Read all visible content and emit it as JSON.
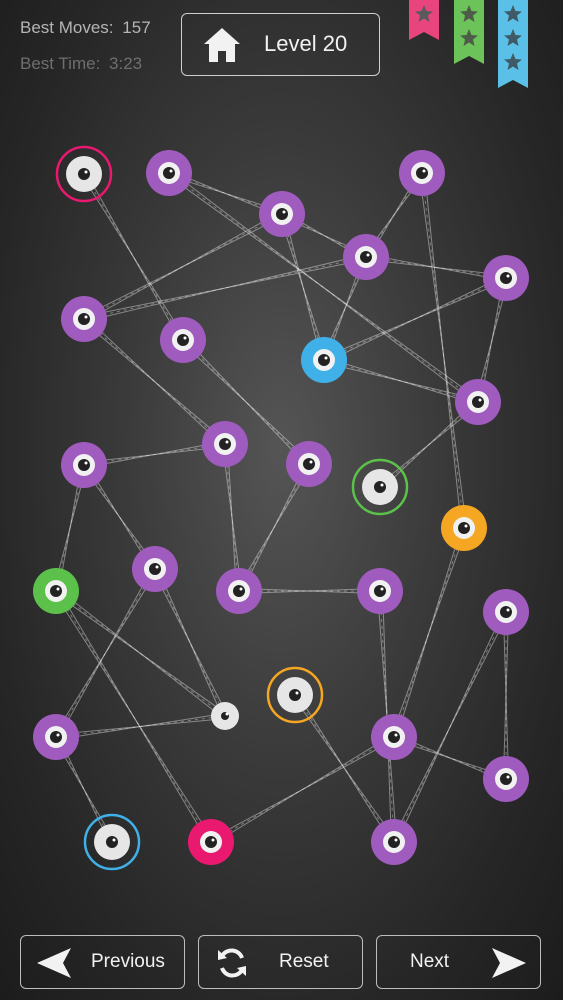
{
  "header": {
    "best_moves_label": "Best Moves:",
    "best_moves_value": "157",
    "best_time_label": "Best Time:",
    "best_time_value": "3:23",
    "level_label": "Level 20",
    "home_icon": "home-icon"
  },
  "ribbons": [
    {
      "color": "#e8457f",
      "stars": 1
    },
    {
      "color": "#6cc35a",
      "stars": 2
    },
    {
      "color": "#5bc0e8",
      "stars": 3
    }
  ],
  "colors": {
    "purple": "#a05bbf",
    "blue": "#3fb0e8",
    "green": "#5cc14a",
    "orange": "#f5a623",
    "pink": "#e8196f",
    "white": "#e6e6e6",
    "ring_pink": "#e8196f",
    "ring_green": "#5cc14a",
    "ring_blue": "#3fb0e8",
    "ring_orange": "#f5a623"
  },
  "nodes": [
    {
      "id": "n1",
      "color": "white",
      "ring": "ring_pink"
    },
    {
      "id": "n2",
      "color": "purple"
    },
    {
      "id": "n3",
      "color": "purple"
    },
    {
      "id": "n4",
      "color": "purple"
    },
    {
      "id": "n5",
      "color": "purple"
    },
    {
      "id": "n6",
      "color": "purple"
    },
    {
      "id": "n7",
      "color": "purple"
    },
    {
      "id": "n8",
      "color": "purple"
    },
    {
      "id": "n9",
      "color": "blue"
    },
    {
      "id": "n10",
      "color": "purple"
    },
    {
      "id": "n11",
      "color": "purple"
    },
    {
      "id": "n12",
      "color": "purple"
    },
    {
      "id": "n13",
      "color": "purple"
    },
    {
      "id": "n14",
      "color": "white",
      "ring": "ring_green"
    },
    {
      "id": "n15",
      "color": "orange"
    },
    {
      "id": "n16",
      "color": "green"
    },
    {
      "id": "n17",
      "color": "purple"
    },
    {
      "id": "n18",
      "color": "purple"
    },
    {
      "id": "n19",
      "color": "purple"
    },
    {
      "id": "n20",
      "color": "purple"
    },
    {
      "id": "n21",
      "color": "white",
      "ring": "ring_orange"
    },
    {
      "id": "n22",
      "color": "white",
      "small": true
    },
    {
      "id": "n23",
      "color": "purple"
    },
    {
      "id": "n24",
      "color": "purple"
    },
    {
      "id": "n25",
      "color": "purple"
    },
    {
      "id": "n26",
      "color": "white",
      "ring": "ring_blue"
    },
    {
      "id": "n27",
      "color": "pink"
    },
    {
      "id": "n28",
      "color": "purple"
    }
  ],
  "edges": [
    [
      "n1",
      "n7"
    ],
    [
      "n2",
      "n3"
    ],
    [
      "n2",
      "n10"
    ],
    [
      "n3",
      "n6"
    ],
    [
      "n3",
      "n9"
    ],
    [
      "n4",
      "n5"
    ],
    [
      "n4",
      "n15"
    ],
    [
      "n5",
      "n6"
    ],
    [
      "n5",
      "n9"
    ],
    [
      "n5",
      "n8"
    ],
    [
      "n6",
      "n11"
    ],
    [
      "n8",
      "n9"
    ],
    [
      "n8",
      "n10"
    ],
    [
      "n9",
      "n10"
    ],
    [
      "n10",
      "n14"
    ],
    [
      "n11",
      "n12"
    ],
    [
      "n11",
      "n18"
    ],
    [
      "n12",
      "n17"
    ],
    [
      "n12",
      "n16"
    ],
    [
      "n13",
      "n18"
    ],
    [
      "n13",
      "n7"
    ],
    [
      "n15",
      "n24"
    ],
    [
      "n16",
      "n22"
    ],
    [
      "n16",
      "n27"
    ],
    [
      "n17",
      "n23"
    ],
    [
      "n17",
      "n22"
    ],
    [
      "n18",
      "n19"
    ],
    [
      "n19",
      "n28"
    ],
    [
      "n20",
      "n28"
    ],
    [
      "n20",
      "n25"
    ],
    [
      "n21",
      "n28"
    ],
    [
      "n23",
      "n22"
    ],
    [
      "n23",
      "n26"
    ],
    [
      "n24",
      "n25"
    ],
    [
      "n27",
      "n24"
    ],
    [
      "n3",
      "n5"
    ]
  ],
  "footer": {
    "previous_label": "Previous",
    "reset_label": "Reset",
    "next_label": "Next"
  }
}
